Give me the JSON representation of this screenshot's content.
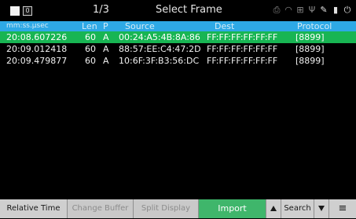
{
  "titlebar": {
    "box_label": "0",
    "page": "1/3",
    "title": "Select Frame",
    "icons": [
      "print-icon",
      "wifi-icon",
      "network-icon",
      "usb-icon",
      "brush-icon",
      "battery-icon",
      "power-plug-icon"
    ]
  },
  "header": {
    "time": "mm:ss.µsec",
    "len": "Len",
    "p": "P",
    "source": "Source",
    "dest": "Dest",
    "protocol": "Protocol"
  },
  "rows": [
    {
      "time": "20:08.607226",
      "len": "60",
      "p": "A",
      "source": "00:24:A5:4B:8A:86",
      "dest": "FF:FF:FF:FF:FF:FF",
      "protocol": "[8899]"
    },
    {
      "time": "20:09.012418",
      "len": "60",
      "p": "A",
      "source": "88:57:EE:C4:47:2D",
      "dest": "FF:FF:FF:FF:FF:FF",
      "protocol": "[8899]"
    },
    {
      "time": "20:09.479877",
      "len": "60",
      "p": "A",
      "source": "10:6F:3F:B3:56:DC",
      "dest": "FF:FF:FF:FF:FF:FF",
      "protocol": "[8899]"
    }
  ],
  "toolbar": {
    "relative_time": "Relative Time",
    "change_buffer": "Change Buffer",
    "split_display": "Split Display",
    "import": "Import",
    "search": "Search"
  },
  "colors": {
    "header_bg": "#2ea9e6",
    "selected_row": "#18b553",
    "import_button": "#3fb66b"
  }
}
